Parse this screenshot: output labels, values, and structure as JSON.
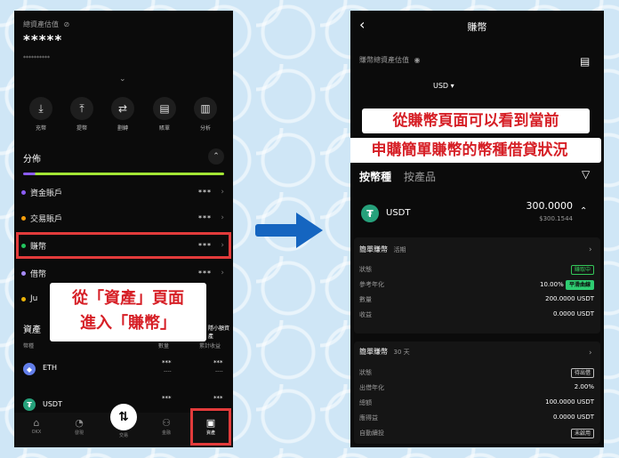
{
  "left": {
    "total_label": "總資產估值",
    "total_value": "*****",
    "sub_value": "**********",
    "actions": [
      {
        "label": "充幣",
        "icon": "deposit-icon",
        "glyph": "⤓"
      },
      {
        "label": "提幣",
        "icon": "withdraw-icon",
        "glyph": "⤒"
      },
      {
        "label": "劃轉",
        "icon": "transfer-icon",
        "glyph": "⇄"
      },
      {
        "label": "賬單",
        "icon": "bill-icon",
        "glyph": "▤"
      },
      {
        "label": "分析",
        "icon": "analytics-icon",
        "glyph": "▥"
      }
    ],
    "distribution_title": "分佈",
    "accounts": [
      {
        "label": "資金賬戶",
        "color": "#8b5cf6",
        "value": "***"
      },
      {
        "label": "交易賬戶",
        "color": "#f59e0b",
        "value": "***"
      },
      {
        "label": "賺幣",
        "color": "#22c55e",
        "value": "***"
      },
      {
        "label": "借幣",
        "color": "#a78bfa",
        "value": "***"
      },
      {
        "label": "Ju",
        "color": "#eab308",
        "value": ""
      }
    ],
    "annotation": [
      "從「資產」頁面",
      "進入「賺幣」"
    ],
    "assets_title": "資產",
    "small_link": "隱小額資產",
    "col_coin": "幣種",
    "col_amount": "數量",
    "col_pnl": "累計收益",
    "coins": [
      {
        "name": "ETH",
        "amount": "***",
        "amount_sub": "----",
        "pnl": "***",
        "pnl_sub": "----",
        "color": "#627eea",
        "glyph": "◆"
      },
      {
        "name": "USDT",
        "amount": "***",
        "amount_sub": "",
        "pnl": "***",
        "pnl_sub": "",
        "color": "#26a17b",
        "glyph": "₮"
      }
    ],
    "nav": [
      {
        "label": "OKX",
        "icon": "home-icon",
        "glyph": "⌂"
      },
      {
        "label": "發現",
        "icon": "discover-icon",
        "glyph": "◔"
      },
      {
        "label": "交易",
        "icon": "trade-icon",
        "glyph": "⇅"
      },
      {
        "label": "金融",
        "icon": "finance-icon",
        "glyph": "⚇"
      },
      {
        "label": "資產",
        "icon": "wallet-icon",
        "glyph": "▣"
      }
    ]
  },
  "right": {
    "title": "賺幣",
    "total_label": "賺幣總資產估值",
    "currency": "USD",
    "headline": [
      "從賺幣頁面可以看到當前",
      "申購簡單賺幣的幣種借貸狀況"
    ],
    "tab_active": "按幣種",
    "tab_inactive": "按產品",
    "coin": {
      "name": "USDT",
      "amount": "300.0000",
      "fiat": "$300.1544"
    },
    "flexible": {
      "title": "簡單賺幣",
      "tag": "活期",
      "rows": [
        {
          "k": "狀態",
          "v": "賺取中",
          "badge": "green"
        },
        {
          "k": "參考年化",
          "v": "10.00%",
          "extra": "平滑曲線"
        },
        {
          "k": "數量",
          "v": "200.0000 USDT"
        },
        {
          "k": "收益",
          "v": "0.0000 USDT"
        }
      ]
    },
    "fixed": {
      "title": "簡單賺幣",
      "tag": "30 天",
      "rows": [
        {
          "k": "狀態",
          "v": "待出借",
          "badge": "plain"
        },
        {
          "k": "出借年化",
          "v": "2.00%"
        },
        {
          "k": "總額",
          "v": "100.0000 USDT"
        },
        {
          "k": "應得益",
          "v": "0.0000 USDT"
        },
        {
          "k": "自動續投",
          "v": "未啟用",
          "badge": "plain"
        }
      ]
    }
  }
}
